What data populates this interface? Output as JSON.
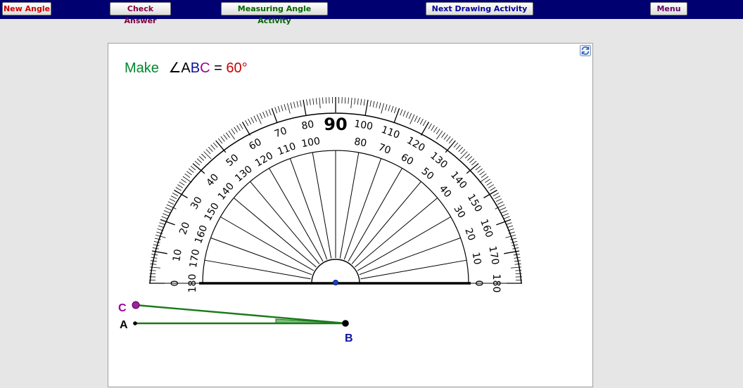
{
  "toolbar": {
    "new_angle": "New Angle",
    "check_answer": "Check Answer",
    "measuring_activity": "Measuring Angle Activity",
    "next_drawing": "Next Drawing Activity",
    "menu": "Menu"
  },
  "prompt": {
    "make": "Make",
    "angle_symbol": "∠",
    "a": "A",
    "b": "B",
    "c": "C",
    "equals": " = ",
    "target": "60°"
  },
  "points": {
    "a": "A",
    "b": "B",
    "c": "C"
  },
  "protractor": {
    "center_label": "90"
  },
  "colors": {
    "toolbar_bg": "#000070",
    "new_angle_text": "#cc0000",
    "check_answer_text": "#800040",
    "measuring_text": "#006600",
    "next_drawing_text": "#000099",
    "menu_text": "#660066",
    "make_text": "#00872e",
    "a_text": "#000000",
    "b_text": "#1010a0",
    "c_text": "#990099",
    "target_text": "#cc0000",
    "ray_color": "#1a7a1a",
    "angle_fill": "#7cbf7c"
  },
  "icons": {
    "refresh": "refresh-icon"
  }
}
